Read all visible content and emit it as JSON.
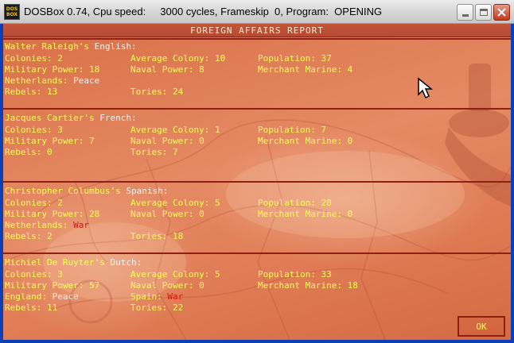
{
  "window": {
    "icon_line1": "DOS",
    "icon_line2": "BOX",
    "title": "DOSBox 0.74, Cpu speed:     3000 cycles, Frameskip  0, Program:  OPENING"
  },
  "report": {
    "title": "FOREIGN AFFAIRS REPORT",
    "ok_label": "OK",
    "nations": [
      {
        "leader": "Walter Raleigh's",
        "nationality": "English:",
        "colonies_label": "Colonies:",
        "colonies": "2",
        "avg_colony_label": "Average Colony:",
        "avg_colony": "10",
        "population_label": "Population:",
        "population": "37",
        "military_label": "Military Power:",
        "military": "18",
        "naval_label": "Naval Power:",
        "naval": "8",
        "merchant_label": "Merchant Marine:",
        "merchant": "4",
        "relation1_label": "Netherlands:",
        "relation1": "Peace",
        "relation2_label": "",
        "relation2": "",
        "rebels_label": "Rebels:",
        "rebels": "13",
        "tories_label": "Tories:",
        "tories": "24"
      },
      {
        "leader": "Jacques Cartier's",
        "nationality": "French:",
        "colonies_label": "Colonies:",
        "colonies": "3",
        "avg_colony_label": "Average Colony:",
        "avg_colony": "1",
        "population_label": "Population:",
        "population": "7",
        "military_label": "Military Power:",
        "military": "7",
        "naval_label": "Naval Power:",
        "naval": "0",
        "merchant_label": "Merchant Marine:",
        "merchant": "0",
        "relation1_label": "",
        "relation1": "",
        "relation2_label": "",
        "relation2": "",
        "rebels_label": "Rebels:",
        "rebels": "0",
        "tories_label": "Tories:",
        "tories": "7"
      },
      {
        "leader": "Christopher Columbus's",
        "nationality": "Spanish:",
        "colonies_label": "Colonies:",
        "colonies": "2",
        "avg_colony_label": "Average Colony:",
        "avg_colony": "5",
        "population_label": "Population:",
        "population": "20",
        "military_label": "Military Power:",
        "military": "28",
        "naval_label": "Naval Power:",
        "naval": "0",
        "merchant_label": "Merchant Marine:",
        "merchant": "0",
        "relation1_label": "Netherlands:",
        "relation1": "War",
        "relation2_label": "",
        "relation2": "",
        "rebels_label": "Rebels:",
        "rebels": "2",
        "tories_label": "Tories:",
        "tories": "18"
      },
      {
        "leader": "Michiel De Ruyter's",
        "nationality": "Dutch:",
        "colonies_label": "Colonies:",
        "colonies": "3",
        "avg_colony_label": "Average Colony:",
        "avg_colony": "5",
        "population_label": "Population:",
        "population": "33",
        "military_label": "Military Power:",
        "military": "57",
        "naval_label": "Naval Power:",
        "naval": "0",
        "merchant_label": "Merchant Marine:",
        "merchant": "18",
        "relation1_label": "England:",
        "relation1": "Peace",
        "relation2_label": "Spain:",
        "relation2": "War",
        "rebels_label": "Rebels:",
        "rebels": "11",
        "tories_label": "Tories:",
        "tories": "22"
      }
    ]
  },
  "colors": {
    "text_yellow": "#ffff55",
    "text_white": "#f3f3f3",
    "war_red": "#e21010",
    "divider": "#8f1f12",
    "parchment": "#e07c55"
  }
}
